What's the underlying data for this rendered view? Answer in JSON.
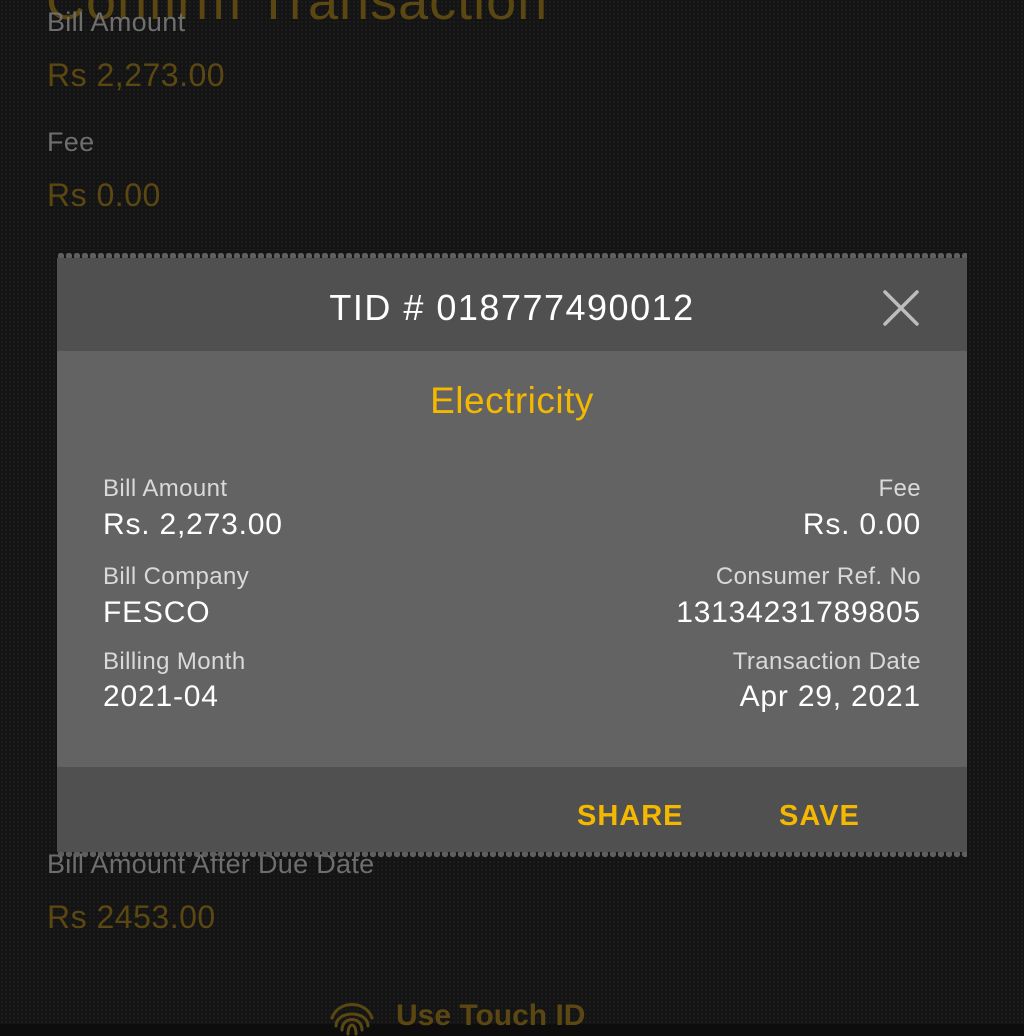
{
  "background": {
    "heading": "Confirm Transaction",
    "fields": [
      {
        "label": "Bill Amount",
        "value": "Rs 2,273.00"
      },
      {
        "label": "Fee",
        "value": "Rs 0.00"
      },
      {
        "label": "Bill Amount After Due Date",
        "value": "Rs 2453.00"
      }
    ],
    "touch_id_label": "Use Touch ID"
  },
  "dialog": {
    "title": "TID # 018777490012",
    "category": "Electricity",
    "bill_amount_label": "Bill Amount",
    "bill_amount_value": "Rs. 2,273.00",
    "fee_label": "Fee",
    "fee_value": "Rs. 0.00",
    "bill_company_label": "Bill Company",
    "bill_company_value": "FESCO",
    "consumer_ref_label": "Consumer Ref. No",
    "consumer_ref_value": "13134231789805",
    "billing_month_label": "Billing Month",
    "billing_month_value": "2021-04",
    "transaction_date_label": "Transaction Date",
    "transaction_date_value": "Apr 29, 2021",
    "share_label": "SHARE",
    "save_label": "SAVE"
  },
  "colors": {
    "accent": "#f5b800",
    "dialog_body": "#636363",
    "dialog_header": "#505050"
  },
  "icons": [
    "close-icon",
    "fingerprint-icon"
  ]
}
